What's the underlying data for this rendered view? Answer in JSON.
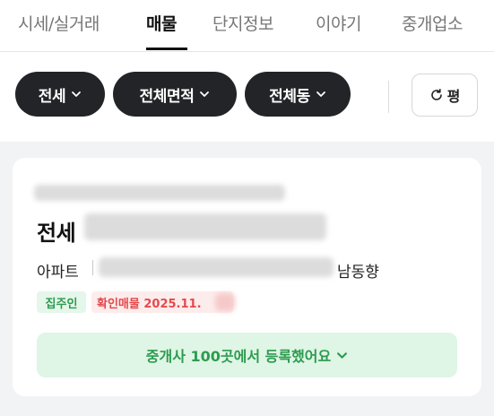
{
  "tabs": [
    {
      "label": "시세/실거래",
      "active": false
    },
    {
      "label": "매물",
      "active": true
    },
    {
      "label": "단지정보",
      "active": false
    },
    {
      "label": "이야기",
      "active": false
    },
    {
      "label": "중개업소",
      "active": false
    }
  ],
  "filters": {
    "trade_type": "전세",
    "area": "전체면적",
    "dong": "전체동",
    "refresh_label": "평"
  },
  "listing": {
    "price_prefix": "전세",
    "property_type": "아파트",
    "direction": "남동향",
    "badge_owner": "집주인",
    "badge_verified": "확인매물 2025.11.",
    "agent_button": "중개사 100곳에서 등록했어요"
  },
  "colors": {
    "chip_bg": "#222427",
    "green_text": "#2c9b4f",
    "green_bg": "#dff5e5",
    "red_text": "#e4494c",
    "red_bg": "#fdecec"
  },
  "icons": {
    "chip_chevron": "chevron-down-icon",
    "refresh": "refresh-icon",
    "agent_chevron": "chevron-down-icon"
  }
}
